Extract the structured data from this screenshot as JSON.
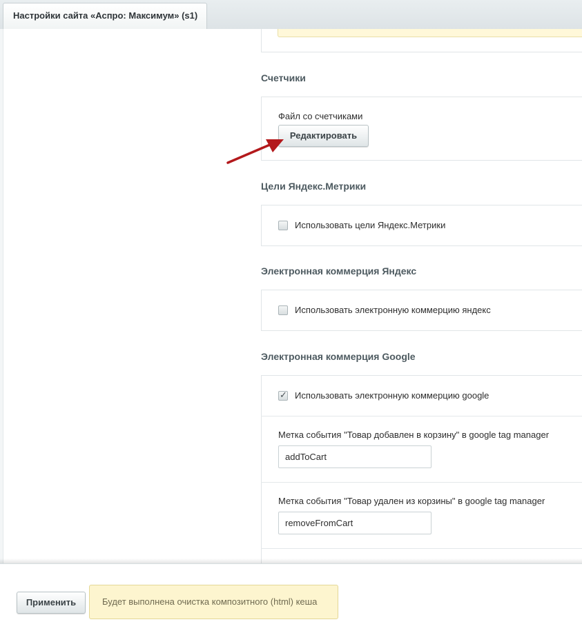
{
  "tab": {
    "title": "Настройки сайта «Аспро: Максимум» (s1)"
  },
  "sections": {
    "counters": {
      "title": "Счетчики",
      "file_label": "Файл со счетчиками",
      "edit_button": "Редактировать"
    },
    "yandex_goals": {
      "title": "Цели Яндекс.Метрики",
      "checkbox_label": "Использовать цели Яндекс.Метрики",
      "checked": false
    },
    "yandex_ecommerce": {
      "title": "Электронная коммерция Яндекс",
      "checkbox_label": "Использовать электронную коммерцию яндекс",
      "checked": false
    },
    "google_ecommerce": {
      "title": "Электронная коммерция Google",
      "checkbox_label": "Использовать электронную коммерцию google",
      "checked": true,
      "add_event_label": "Метка события \"Товар добавлен в корзину\" в google tag manager",
      "add_event_value": "addToCart",
      "remove_event_label": "Метка события \"Товар удален из корзины\" в google tag manager",
      "remove_event_value": "removeFromCart"
    }
  },
  "footer": {
    "apply_button": "Применить",
    "notice": "Будет выполнена очистка композитного (html) кеша"
  },
  "colors": {
    "annotation_arrow": "#b3191c",
    "notice_background": "#fdf5cf"
  },
  "icons": {
    "annotation": "red-arrow-icon",
    "checkbox_checked": "checkmark-icon"
  }
}
